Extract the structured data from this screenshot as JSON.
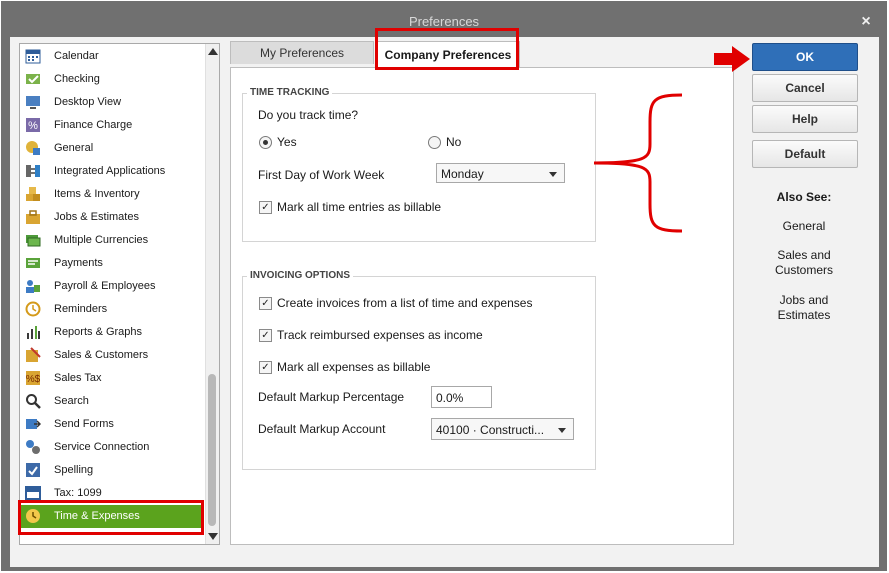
{
  "window": {
    "title": "Preferences",
    "close_glyph": "×"
  },
  "categories": [
    {
      "label": "Calendar",
      "icon": "calendar-icon"
    },
    {
      "label": "Checking",
      "icon": "checking-icon"
    },
    {
      "label": "Desktop View",
      "icon": "desktop-view-icon"
    },
    {
      "label": "Finance Charge",
      "icon": "percent-icon"
    },
    {
      "label": "General",
      "icon": "general-icon"
    },
    {
      "label": "Integrated Applications",
      "icon": "integrated-apps-icon"
    },
    {
      "label": "Items & Inventory",
      "icon": "boxes-icon"
    },
    {
      "label": "Jobs & Estimates",
      "icon": "jobs-icon"
    },
    {
      "label": "Multiple Currencies",
      "icon": "currency-icon"
    },
    {
      "label": "Payments",
      "icon": "payments-icon"
    },
    {
      "label": "Payroll & Employees",
      "icon": "payroll-icon"
    },
    {
      "label": "Reminders",
      "icon": "reminders-icon"
    },
    {
      "label": "Reports & Graphs",
      "icon": "bar-chart-icon"
    },
    {
      "label": "Sales & Customers",
      "icon": "sales-icon"
    },
    {
      "label": "Sales Tax",
      "icon": "sales-tax-icon"
    },
    {
      "label": "Search",
      "icon": "search-icon"
    },
    {
      "label": "Send Forms",
      "icon": "send-forms-icon"
    },
    {
      "label": "Service Connection",
      "icon": "service-connection-icon"
    },
    {
      "label": "Spelling",
      "icon": "spelling-icon"
    },
    {
      "label": "Tax: 1099",
      "icon": "tax-1099-icon"
    },
    {
      "label": "Time & Expenses",
      "icon": "clock-icon",
      "selected": true
    }
  ],
  "tabs": {
    "my": "My Preferences",
    "company": "Company Preferences"
  },
  "time_tracking": {
    "title": "TIME TRACKING",
    "question": "Do you track time?",
    "yes": "Yes",
    "no": "No",
    "selected": "Yes",
    "first_day_label": "First Day of Work Week",
    "first_day_value": "Monday",
    "billable_label": "Mark all time entries as billable",
    "billable_checked": true
  },
  "invoicing": {
    "title": "INVOICING OPTIONS",
    "opt1": "Create invoices from a list of time and expenses",
    "opt2": "Track reimbursed expenses as income",
    "opt3": "Mark all expenses as billable",
    "markup_pct_label": "Default Markup Percentage",
    "markup_pct_value": "0.0%",
    "markup_acct_label": "Default Markup Account",
    "markup_acct_value": "40100 · Constructi..."
  },
  "buttons": {
    "ok": "OK",
    "cancel": "Cancel",
    "help": "Help",
    "default": "Default"
  },
  "also_see": {
    "title": "Also See:",
    "links": [
      "General",
      "Sales and Customers",
      "Jobs and Estimates"
    ]
  },
  "colors": {
    "selected_bg": "#5ba31d",
    "ok_blue": "#2f6fb8",
    "annotation_red": "#e00000"
  }
}
